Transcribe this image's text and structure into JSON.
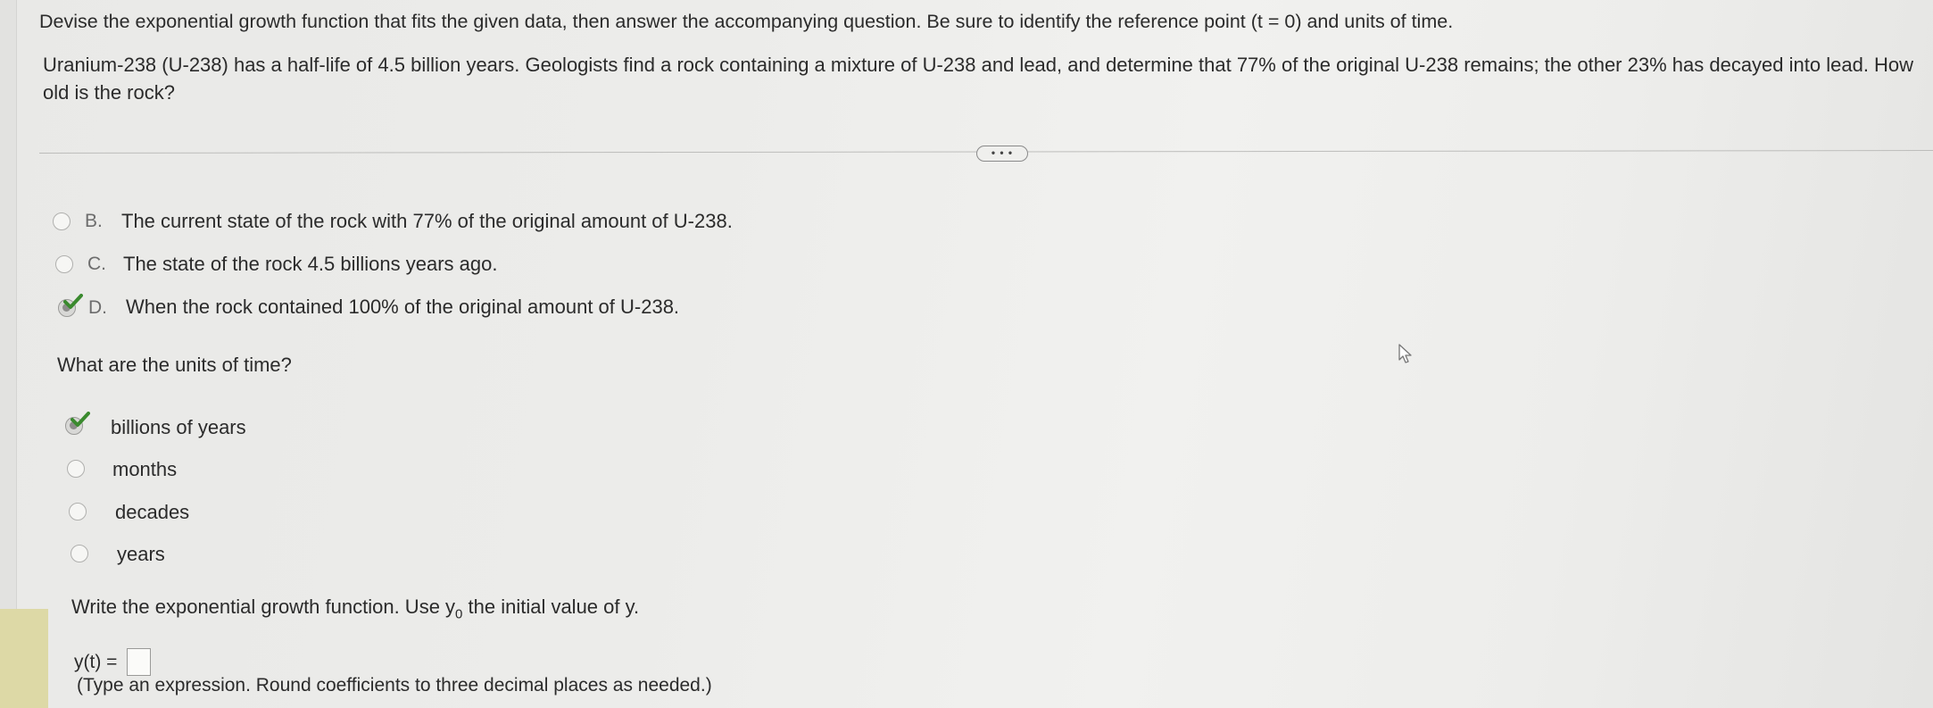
{
  "instructions": "Devise the exponential growth function that fits the given data, then answer the accompanying question. Be sure to identify the reference point (t = 0) and units of time.",
  "problem": "Uranium-238 (U-238) has a half-life of 4.5 billion years. Geologists find a rock containing a mixture of U-238 and lead, and determine that 77% of the original U-238 remains; the other 23% has decayed into lead. How old is the rock?",
  "more_button": "• • •",
  "reference_options": [
    {
      "letter": "B.",
      "text": "The current state of the rock with 77% of the original amount of U-238.",
      "selected": false
    },
    {
      "letter": "C.",
      "text": "The state of the rock 4.5 billions years ago.",
      "selected": false
    },
    {
      "letter": "D.",
      "text": "When the rock contained 100% of the original amount of U-238.",
      "selected": true
    }
  ],
  "units_question": "What are the units of time?",
  "unit_options": [
    {
      "text": "billions of years",
      "selected": true
    },
    {
      "text": "months",
      "selected": false
    },
    {
      "text": "decades",
      "selected": false
    },
    {
      "text": "years",
      "selected": false
    }
  ],
  "function_prompt": {
    "before": "Write the exponential growth function. Use y",
    "subscript": "0",
    "after": " the initial value of y."
  },
  "answer_label": "y(t) =",
  "answer_value": "",
  "answer_hint": "(Type an expression. Round coefficients to three decimal places as needed.)",
  "colors": {
    "check": "#3a8a2e",
    "text": "#2b2b2b",
    "radio_border": "#b0b0ae"
  }
}
